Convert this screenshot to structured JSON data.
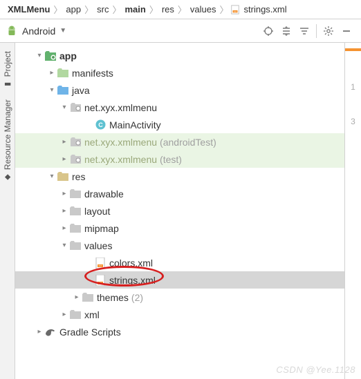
{
  "breadcrumb": {
    "items": [
      "XMLMenu",
      "app",
      "src",
      "main",
      "res",
      "values",
      "strings.xml"
    ],
    "bold": [
      0,
      3
    ]
  },
  "toolbar": {
    "view_label": "Android"
  },
  "sidetabs": {
    "project": "Project",
    "resource_manager": "Resource Manager"
  },
  "tree": {
    "app": "app",
    "manifests": "manifests",
    "java": "java",
    "pkg_main": "net.xyx.xmlmenu",
    "main_activity": "MainActivity",
    "pkg_androidtest": "net.xyx.xmlmenu",
    "pkg_androidtest_suffix": "(androidTest)",
    "pkg_test": "net.xyx.xmlmenu",
    "pkg_test_suffix": "(test)",
    "res": "res",
    "drawable": "drawable",
    "layout": "layout",
    "mipmap": "mipmap",
    "values": "values",
    "colors_xml": "colors.xml",
    "strings_xml": "strings.xml",
    "themes": "themes",
    "themes_suffix": "(2)",
    "xml": "xml",
    "gradle_scripts": "Gradle Scripts"
  },
  "gutter": {
    "lines": [
      "1",
      "3"
    ]
  },
  "watermark": "CSDN @Yee.1128"
}
